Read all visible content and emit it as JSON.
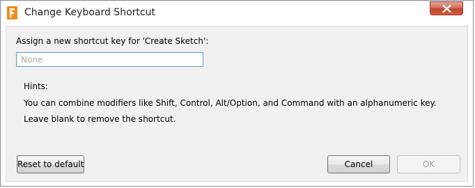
{
  "window": {
    "title": "Change Keyboard Shortcut",
    "app_icon": "fusion-app-icon",
    "close_icon": "close-icon"
  },
  "dialog": {
    "prompt": "Assign a new shortcut key for 'Create Sketch':",
    "input": {
      "value": "",
      "placeholder": "None"
    },
    "hints": {
      "title": "Hints:",
      "lines": [
        "You can combine modifiers like Shift, Control, Alt/Option, and Command with an alphanumeric key.",
        "Leave blank to remove the shortcut."
      ]
    }
  },
  "buttons": {
    "reset": "Reset to default",
    "cancel": "Cancel",
    "ok": "OK",
    "ok_enabled": false
  },
  "colors": {
    "app_icon_orange": "#f08b1d",
    "close_button_red": "#c2442c",
    "input_border_focus": "#5b9bd5",
    "client_background": "#f0f0f0"
  }
}
